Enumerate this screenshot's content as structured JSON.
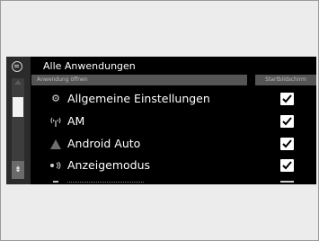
{
  "screen": {
    "title": "Alle Anwendungen",
    "columns": {
      "app": "Anwendung öffnen",
      "home": "Startbildschirm"
    },
    "items": [
      {
        "label": "Allgemeine Einstellungen",
        "icon": "gear-icon",
        "glyph": "⚙",
        "checked": true
      },
      {
        "label": "AM",
        "icon": "antenna-icon",
        "glyph": "📶",
        "checked": true
      },
      {
        "label": "Android Auto",
        "icon": "android-auto-icon",
        "glyph": "▲",
        "checked": true
      },
      {
        "label": "Anzeigemodus",
        "icon": "display-mode-icon",
        "glyph": "◦◦",
        "checked": true
      }
    ],
    "scroll_down_glyph": "⇟"
  }
}
